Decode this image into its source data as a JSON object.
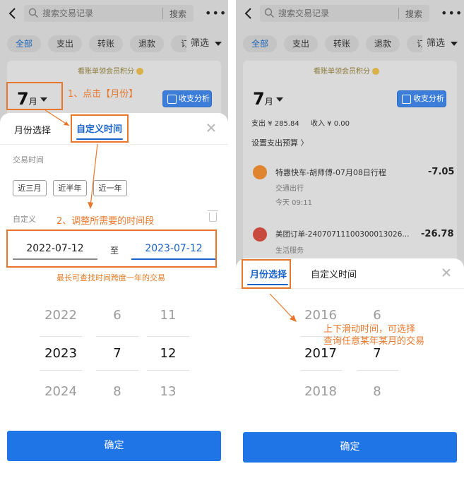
{
  "common": {
    "search_placeholder": "搜索交易记录",
    "search_button": "搜索",
    "more": "•••",
    "filter_chips": [
      "全部",
      "支出",
      "转账",
      "退款",
      "订"
    ],
    "filter_button": "筛选",
    "vip_strip": "看账单领会员积分",
    "month_number": "7",
    "month_unit": "月",
    "analysis_button": "收支分析",
    "confirm_button": "确定",
    "tab_month": "月份选择",
    "tab_custom": "自定义时间"
  },
  "left": {
    "txn_time_label": "交易时间",
    "quick_ranges": [
      "近三月",
      "近半年",
      "近一年"
    ],
    "custom_label": "自定义",
    "start_date": "2022-07-12",
    "to_label": "至",
    "end_date": "2023-07-12",
    "range_hint": "最长可查找时间跨度一年的交易",
    "wheel_years": [
      "2022",
      "2023",
      "2024"
    ],
    "wheel_months": [
      "6",
      "7",
      "8"
    ],
    "wheel_days": [
      "11",
      "12",
      "13"
    ],
    "annotation_1": "1、点击【月份】",
    "annotation_2": "2、调整所需要的时间段"
  },
  "right": {
    "summary_out": "支出 ¥ 285.84",
    "summary_in": "收入 ¥ 0.00",
    "budget_link": "设置支出预算 〉",
    "transactions": [
      {
        "title": "特惠快车-胡师傅-07月08日行程",
        "category": "交通出行",
        "time": "今天 09:11",
        "amount": "-7.05",
        "color": "#e0852f"
      },
      {
        "title": "美团订单-24070711100300013026...",
        "category": "生活服务",
        "time": "",
        "amount": "-26.78",
        "color": "#c8493e"
      }
    ],
    "wheel_years": [
      "2016",
      "2017",
      "2018"
    ],
    "wheel_months": [
      "6",
      "7",
      "8"
    ],
    "annotation_line1": "上下滑动时间，可选择",
    "annotation_line2": "查询任意某年某月的交易"
  },
  "colors": {
    "accent": "#1a63c9",
    "confirm": "#1f74e6",
    "annotation": "#e8772b"
  }
}
